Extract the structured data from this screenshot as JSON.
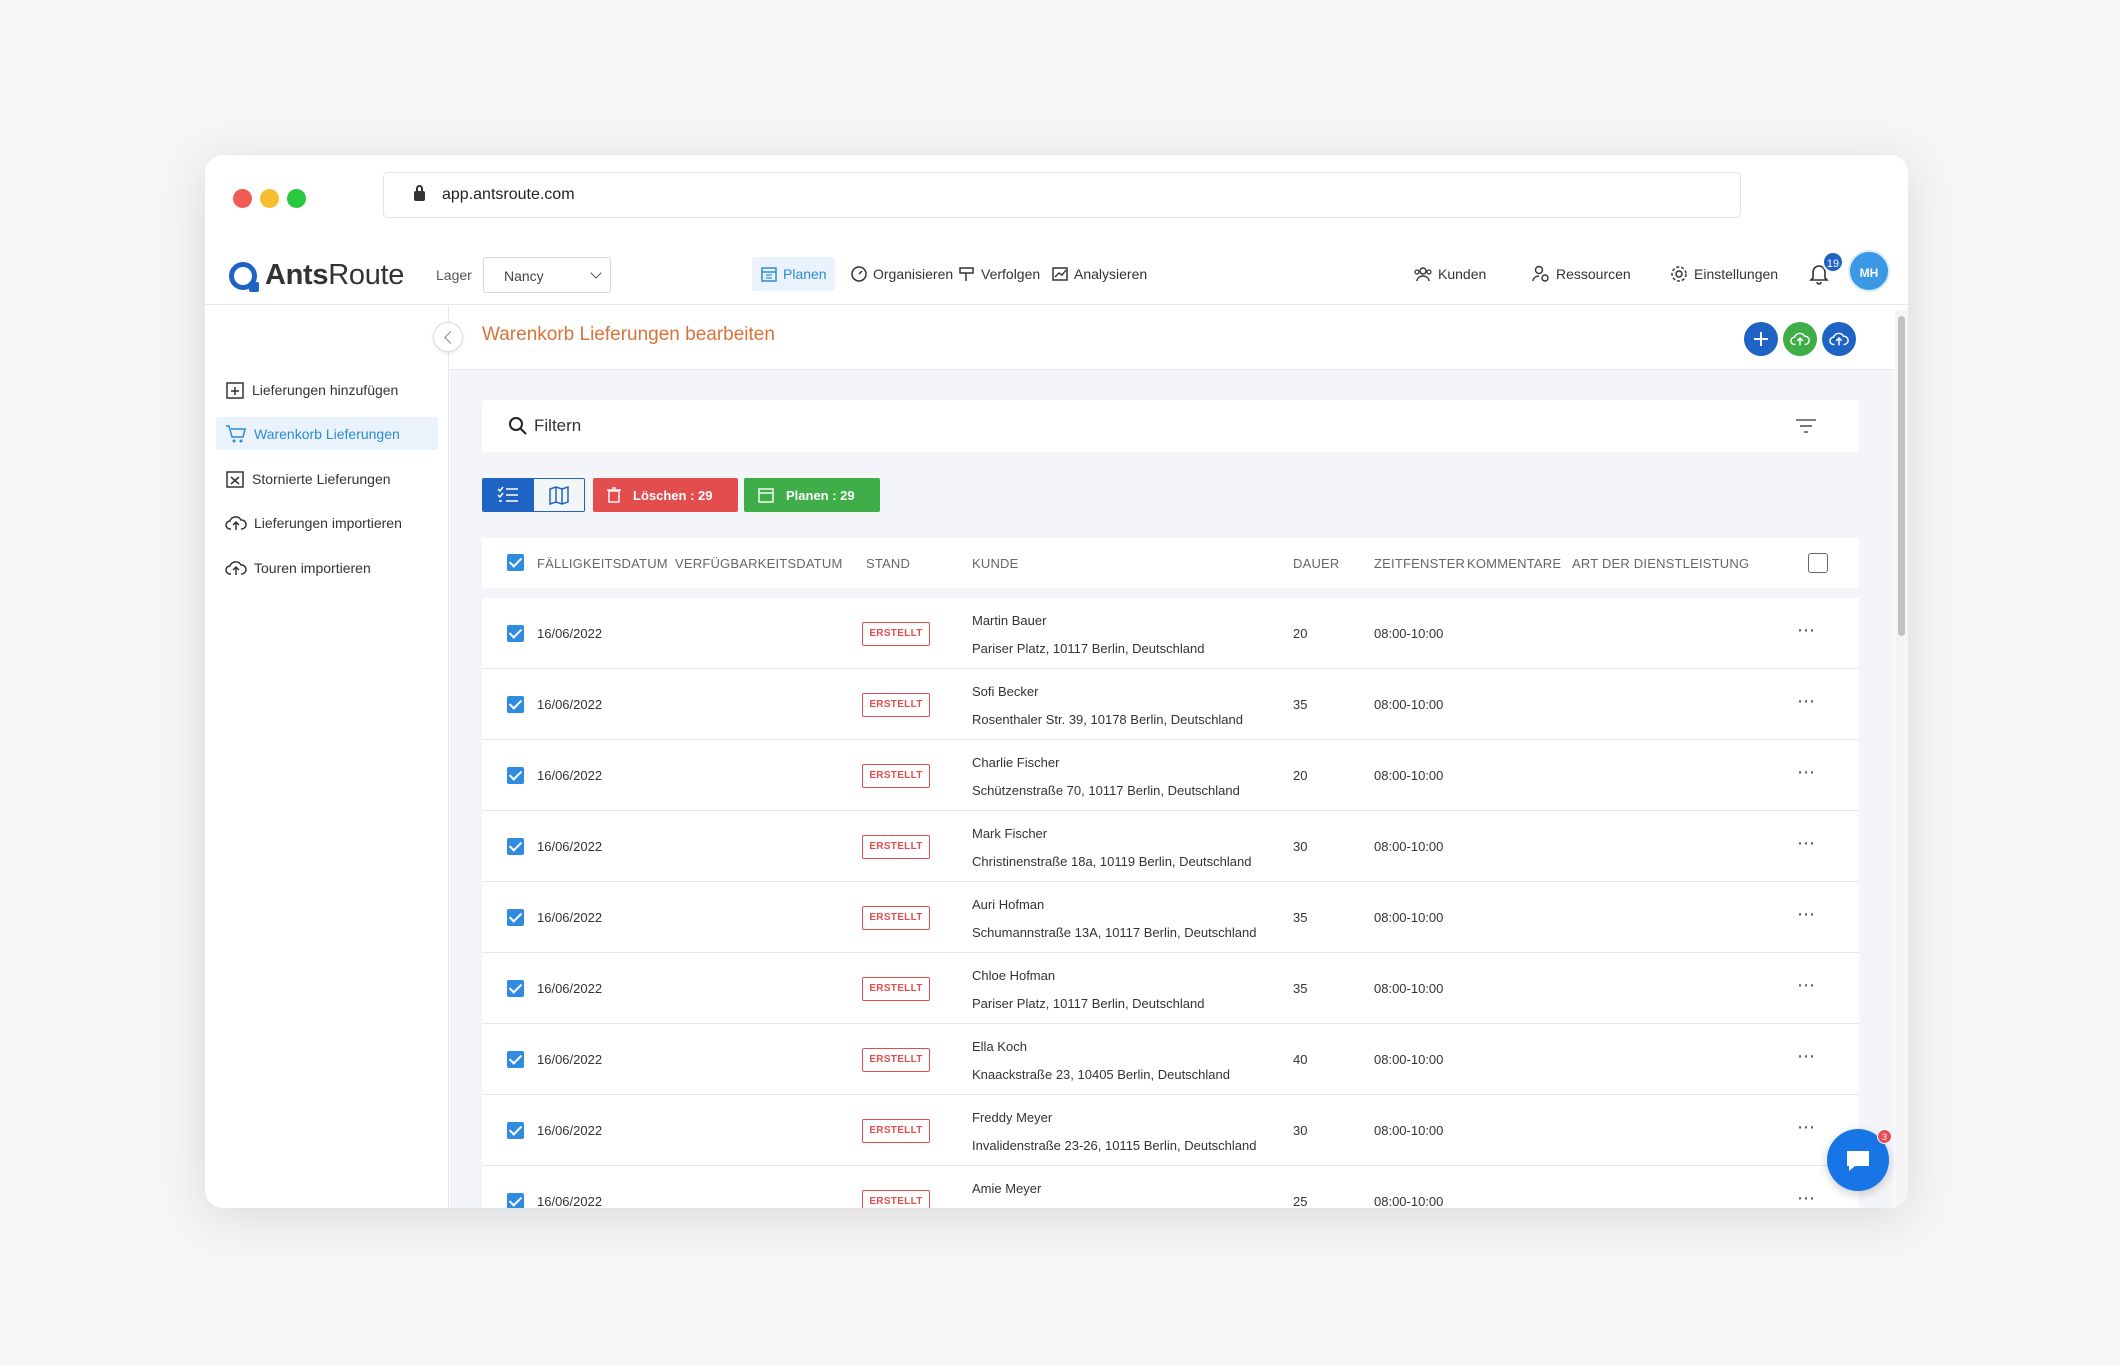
{
  "browser": {
    "url": "app.antsroute.com"
  },
  "brand": {
    "name_bold": "Ants",
    "name_light": "Route"
  },
  "lager": {
    "label": "Lager",
    "value": "Nancy"
  },
  "nav": [
    {
      "label": "Planen",
      "icon": "calendar-icon",
      "active": true
    },
    {
      "label": "Organisieren",
      "icon": "gauge-icon",
      "active": false
    },
    {
      "label": "Verfolgen",
      "icon": "signpost-icon",
      "active": false
    },
    {
      "label": "Analysieren",
      "icon": "chart-icon",
      "active": false
    }
  ],
  "nav_right": [
    {
      "label": "Kunden",
      "icon": "users-icon"
    },
    {
      "label": "Ressourcen",
      "icon": "user-gear-icon"
    },
    {
      "label": "Einstellungen",
      "icon": "gear-icon"
    }
  ],
  "notifications": {
    "count": "19"
  },
  "user": {
    "initials": "MH"
  },
  "sidebar": {
    "items": [
      {
        "label": "Lieferungen hinzufügen",
        "icon": "calendar-plus-icon",
        "active": false
      },
      {
        "label": "Warenkorb Lieferungen",
        "icon": "cart-icon",
        "active": true
      },
      {
        "label": "Stornierte Lieferungen",
        "icon": "calendar-x-icon",
        "active": false
      },
      {
        "label": "Lieferungen importieren",
        "icon": "cloud-upload-icon",
        "active": false
      },
      {
        "label": "Touren importieren",
        "icon": "cloud-upload-icon",
        "active": false
      }
    ]
  },
  "page": {
    "title": "Warenkorb Lieferungen bearbeiten"
  },
  "filter": {
    "label": "Filtern"
  },
  "actions": {
    "delete_label": "Löschen : 29",
    "plan_label": "Planen : 29"
  },
  "table": {
    "headers": {
      "due": "FÄLLIGKEITSDATUM",
      "avail": "VERFÜGBARKEITSDATUM",
      "status": "STAND",
      "customer": "KUNDE",
      "duration": "DAUER",
      "window": "ZEITFENSTER",
      "comments": "KOMMENTARE",
      "service": "ART DER DIENSTLEISTUNG"
    },
    "rows": [
      {
        "date": "16/06/2022",
        "status": "ERSTELLT",
        "name": "Martin Bauer",
        "address": "Pariser Platz, 10117 Berlin, Deutschland",
        "duration": "20",
        "window": "08:00-10:00"
      },
      {
        "date": "16/06/2022",
        "status": "ERSTELLT",
        "name": "Sofi Becker",
        "address": "Rosenthaler Str. 39, 10178 Berlin, Deutschland",
        "duration": "35",
        "window": "08:00-10:00"
      },
      {
        "date": "16/06/2022",
        "status": "ERSTELLT",
        "name": "Charlie Fischer",
        "address": "Schützenstraße 70, 10117 Berlin, Deutschland",
        "duration": "20",
        "window": "08:00-10:00"
      },
      {
        "date": "16/06/2022",
        "status": "ERSTELLT",
        "name": "Mark Fischer",
        "address": "Christinenstraße 18a, 10119 Berlin, Deutschland",
        "duration": "30",
        "window": "08:00-10:00"
      },
      {
        "date": "16/06/2022",
        "status": "ERSTELLT",
        "name": "Auri Hofman",
        "address": "Schumannstraße 13A, 10117 Berlin, Deutschland",
        "duration": "35",
        "window": "08:00-10:00"
      },
      {
        "date": "16/06/2022",
        "status": "ERSTELLT",
        "name": "Chloe Hofman",
        "address": "Pariser Platz, 10117 Berlin, Deutschland",
        "duration": "35",
        "window": "08:00-10:00"
      },
      {
        "date": "16/06/2022",
        "status": "ERSTELLT",
        "name": "Ella Koch",
        "address": "Knaackstraße 23, 10405 Berlin, Deutschland",
        "duration": "40",
        "window": "08:00-10:00"
      },
      {
        "date": "16/06/2022",
        "status": "ERSTELLT",
        "name": "Freddy Meyer",
        "address": "Invalidenstraße 23-26, 10115 Berlin, Deutschland",
        "duration": "30",
        "window": "08:00-10:00"
      },
      {
        "date": "16/06/2022",
        "status": "ERSTELLT",
        "name": "Amie Meyer",
        "address": "",
        "duration": "25",
        "window": "08:00-10:00"
      }
    ]
  },
  "chat": {
    "badge": "3"
  },
  "colors": {
    "accent": "#1f64c4",
    "title": "#d8743b",
    "danger": "#e34d4d",
    "success": "#3fae49"
  }
}
